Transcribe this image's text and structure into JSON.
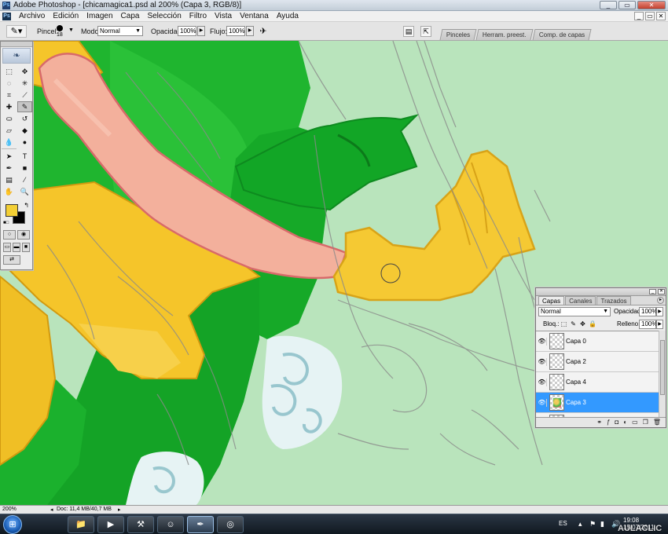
{
  "window": {
    "title": "Adobe Photoshop - [chicamagica1.psd al 200% (Capa 3, RGB/8)]",
    "buttons": [
      "_",
      "▭",
      "✕"
    ]
  },
  "menu": {
    "items": [
      "Archivo",
      "Edición",
      "Imagen",
      "Capa",
      "Selección",
      "Filtro",
      "Vista",
      "Ventana",
      "Ayuda"
    ]
  },
  "options": {
    "brush_label": "Pincel:",
    "brush_size": "18",
    "mode_label": "Modo:",
    "mode_value": "Normal",
    "opacity_label": "Opacidad:",
    "opacity_value": "100%",
    "flow_label": "Flujo:",
    "flow_value": "100%",
    "well_tabs": [
      "Pinceles",
      "Herram. preest.",
      "Comp. de capas"
    ]
  },
  "toolbox": {
    "colors": {
      "foreground": "#f3cf35",
      "background": "#000000"
    }
  },
  "layers_panel": {
    "tabs": [
      "Capas",
      "Canales",
      "Trazados"
    ],
    "blend_mode": "Normal",
    "opacity_label": "Opacidad:",
    "opacity_value": "100%",
    "lock_label": "Bloq.:",
    "fill_label": "Relleno:",
    "fill_value": "100%",
    "layers": [
      {
        "name": "Capa 0",
        "selected": false
      },
      {
        "name": "Capa 2",
        "selected": false
      },
      {
        "name": "Capa 4",
        "selected": false
      },
      {
        "name": "Capa 3",
        "selected": true
      }
    ]
  },
  "status": {
    "zoom": "200%",
    "doc": "Doc: 11,4 MB/40,7 MB"
  },
  "taskbar": {
    "lang": "ES",
    "time": "19:08",
    "date": "15/07/2011"
  },
  "watermark": "AULACLIC"
}
